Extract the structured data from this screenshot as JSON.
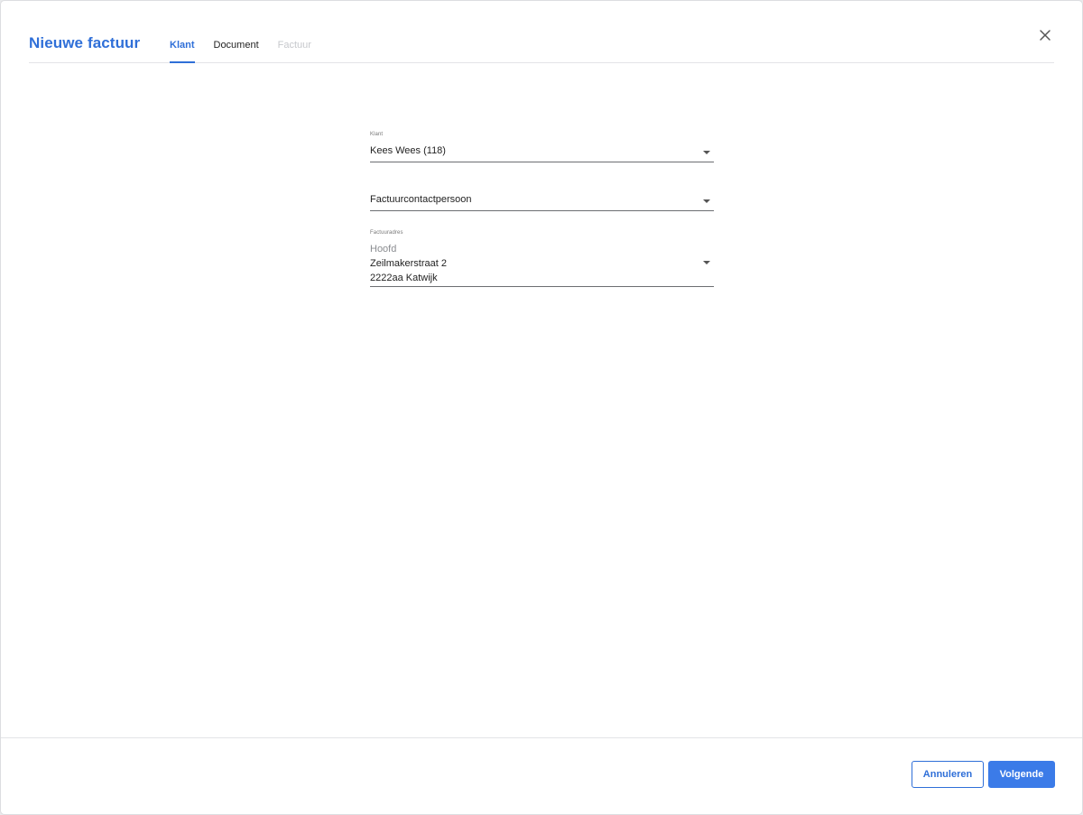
{
  "dialog": {
    "title": "Nieuwe factuur",
    "close_icon": "close-icon"
  },
  "tabs": [
    {
      "label": "Klant",
      "state": "active"
    },
    {
      "label": "Document",
      "state": "enabled"
    },
    {
      "label": "Factuur",
      "state": "disabled"
    }
  ],
  "form": {
    "klant": {
      "label": "Klant",
      "value": "Kees Wees (118)"
    },
    "contactpersoon": {
      "placeholder": "Factuurcontactpersoon"
    },
    "factuuradres": {
      "label": "Factuuradres",
      "name": "Hoofd",
      "street": "Zeilmakerstraat 2",
      "city": "2222aa Katwijk"
    }
  },
  "footer": {
    "cancel_label": "Annuleren",
    "next_label": "Volgende"
  },
  "colors": {
    "accent": "#2f6fd8",
    "primary_button": "#3b7be8"
  }
}
